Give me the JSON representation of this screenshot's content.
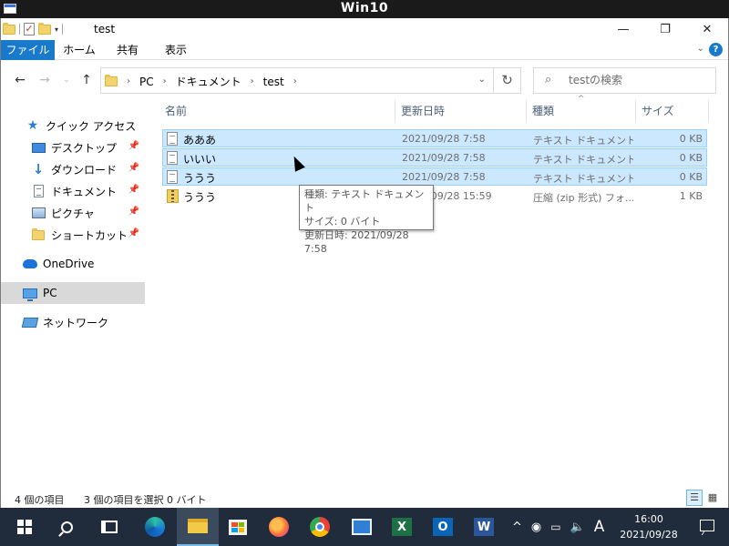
{
  "vm": {
    "title": "Win10"
  },
  "window": {
    "title": "test",
    "controls": {
      "minimize": "—",
      "restore": "❐",
      "close": "✕"
    }
  },
  "ribbon": {
    "tabs": [
      "ファイル",
      "ホーム",
      "共有",
      "表示"
    ],
    "expand": "⌄",
    "help": "?"
  },
  "address": {
    "crumbs": [
      "PC",
      "ドキュメント",
      "test"
    ],
    "search_placeholder": "testの検索"
  },
  "sidebar": {
    "items": [
      {
        "label": "クイック アクセス",
        "icon": "star-icon",
        "pinned": false
      },
      {
        "label": "デスクトップ",
        "icon": "desktop-icon",
        "pinned": true
      },
      {
        "label": "ダウンロード",
        "icon": "download-icon",
        "pinned": true
      },
      {
        "label": "ドキュメント",
        "icon": "document-icon",
        "pinned": true
      },
      {
        "label": "ピクチャ",
        "icon": "picture-icon",
        "pinned": true
      },
      {
        "label": "ショートカット",
        "icon": "folder-icon",
        "pinned": true
      },
      {
        "label": "OneDrive",
        "icon": "cloud-icon",
        "pinned": false
      },
      {
        "label": "PC",
        "icon": "pc-icon",
        "pinned": false,
        "selected": true
      },
      {
        "label": "ネットワーク",
        "icon": "network-icon",
        "pinned": false
      }
    ]
  },
  "columns": {
    "name": "名前",
    "date": "更新日時",
    "type": "種類",
    "size": "サイズ"
  },
  "files": [
    {
      "name": "あああ",
      "date": "2021/09/28 7:58",
      "type": "テキスト ドキュメント",
      "size": "0 KB",
      "selected": true,
      "kind": "text"
    },
    {
      "name": "いいい",
      "date": "2021/09/28 7:58",
      "type": "テキスト ドキュメント",
      "size": "0 KB",
      "selected": true,
      "kind": "text"
    },
    {
      "name": "ううう",
      "date": "2021/09/28 7:58",
      "type": "テキスト ドキュメント",
      "size": "0 KB",
      "selected": true,
      "kind": "text"
    },
    {
      "name": "ううう",
      "date": "2021/09/28 15:59",
      "type": "圧縮 (zip 形式) フォ...",
      "size": "1 KB",
      "selected": false,
      "kind": "zip"
    }
  ],
  "tooltip": {
    "line1": "種類: テキスト ドキュメント",
    "line2": "サイズ: 0 バイト",
    "line3": "更新日時: 2021/09/28 7:58"
  },
  "status": {
    "count": "4 個の項目",
    "selection": "3 個の項目を選択  0 バイト"
  },
  "taskbar": {
    "ime": "A",
    "time": "16:00",
    "date": "2021/09/28"
  }
}
